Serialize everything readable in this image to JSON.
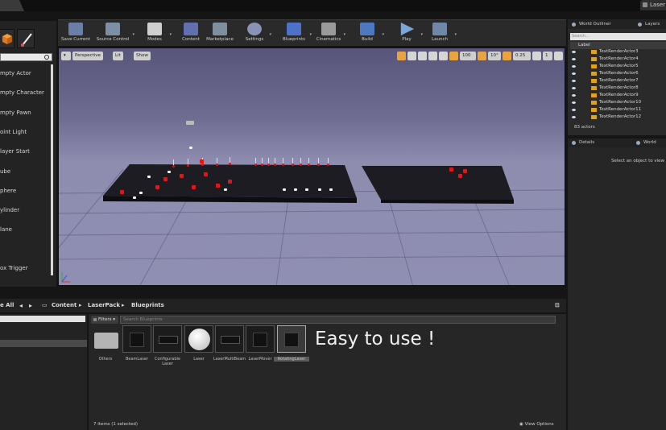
{
  "window": {
    "tab_right": "Laser"
  },
  "place_mode": {
    "items": [
      "mpty Actor",
      "mpty Character",
      "mpty Pawn",
      "oint Light",
      "layer Start",
      "ube",
      "phere",
      "ylinder",
      "lane",
      "ox Trigger"
    ]
  },
  "toolbar": {
    "buttons": [
      {
        "label": "Save Current",
        "icon": "save-icon",
        "color": "#6a7fa8"
      },
      {
        "label": "Source Control",
        "icon": "source-control-icon",
        "color": "#7d8fa5"
      },
      {
        "label": "Modes",
        "icon": "modes-icon",
        "color": "#cfcfcf"
      },
      {
        "label": "Content",
        "icon": "content-icon",
        "color": "#6070b0"
      },
      {
        "label": "Marketplace",
        "icon": "marketplace-icon",
        "color": "#7f8fa0"
      },
      {
        "label": "Settings",
        "icon": "settings-icon",
        "color": "#8a93b5"
      },
      {
        "label": "Blueprints",
        "icon": "blueprints-icon",
        "color": "#4e72c8"
      },
      {
        "label": "Cinematics",
        "icon": "cinematics-icon",
        "color": "#9a9a9a"
      },
      {
        "label": "Build",
        "icon": "build-icon",
        "color": "#4d78c2"
      },
      {
        "label": "Play",
        "icon": "play-icon",
        "color": "#7aa7d8"
      },
      {
        "label": "Launch",
        "icon": "launch-icon",
        "color": "#6f88a8"
      }
    ]
  },
  "viewport": {
    "perspective": "Perspective",
    "lit": "Lit",
    "show": "Show",
    "grid_snap": "100",
    "rot_snap": "10°",
    "scale_snap": "0.25",
    "cam_speed": "1"
  },
  "outliner": {
    "tabs": [
      "World Outliner",
      "Layers"
    ],
    "search_placeholder": "Search...",
    "label_header": "Label",
    "rows": [
      "TextRenderActor3",
      "TextRenderActor4",
      "TextRenderActor5",
      "TextRenderActor6",
      "TextRenderActor7",
      "TextRenderActor8",
      "TextRenderActor9",
      "TextRenderActor10",
      "TextRenderActor11",
      "TextRenderActor12"
    ],
    "actor_count": "83 actors"
  },
  "details": {
    "tabs": [
      "Details",
      "World Setti"
    ],
    "hint": "Select an object to view"
  },
  "content_browser": {
    "all_label": "e All",
    "breadcrumbs": [
      "Content",
      "LaserPack",
      "Blueprints"
    ],
    "filters": "Filters",
    "search_placeholder": "Search Blueprints",
    "assets": [
      {
        "name": "Others",
        "kind": "folder"
      },
      {
        "name": "BeamLaser",
        "kind": "box"
      },
      {
        "name": "Configurable Laser",
        "kind": "flat"
      },
      {
        "name": "Laser",
        "kind": "sphere"
      },
      {
        "name": "LaserMultiBeam",
        "kind": "flat"
      },
      {
        "name": "LaserMover",
        "kind": "box"
      },
      {
        "name": "RotatingLaser",
        "kind": "box"
      }
    ],
    "overlay_text": "Easy to use !",
    "items_count": "7 items (1 selected)",
    "view_options": "View Options"
  }
}
